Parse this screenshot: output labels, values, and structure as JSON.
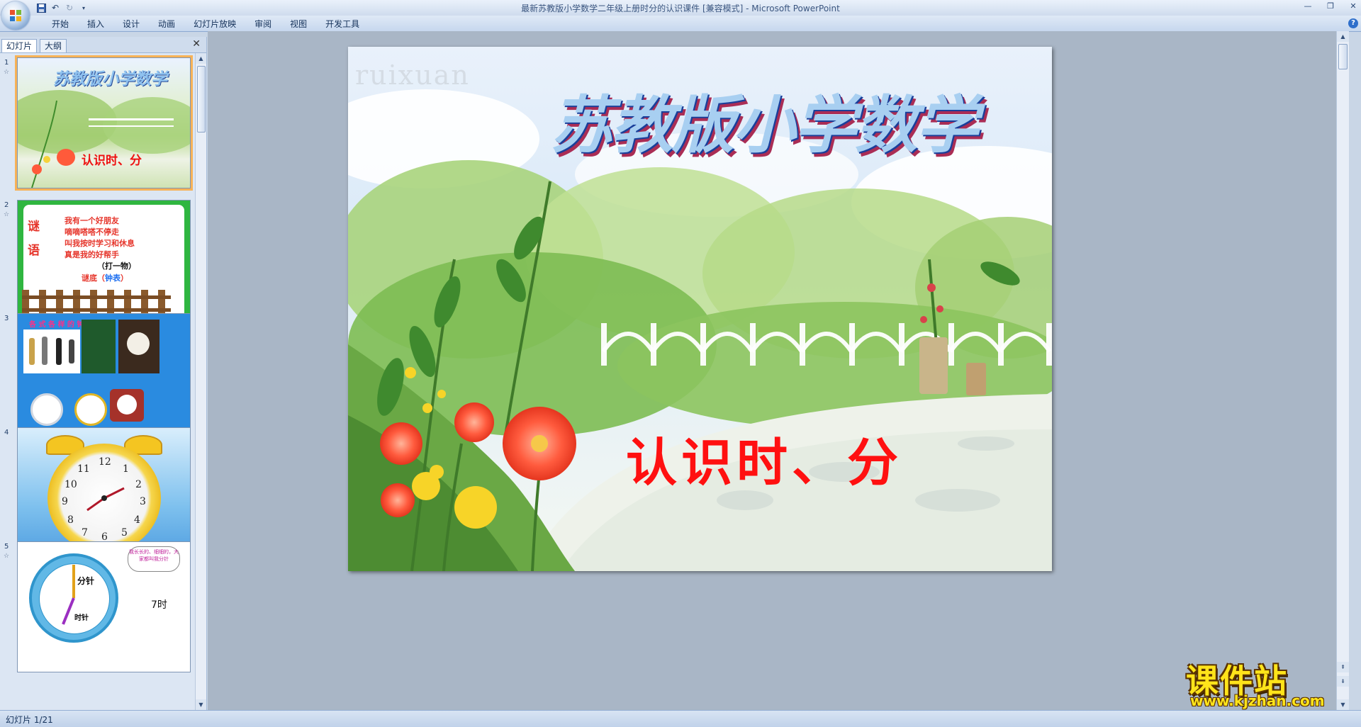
{
  "window": {
    "title": "最新苏教版小学数学二年级上册时分的认识课件 [兼容模式] - Microsoft PowerPoint"
  },
  "ribbon": {
    "tabs": [
      "开始",
      "插入",
      "设计",
      "动画",
      "幻灯片放映",
      "审阅",
      "视图",
      "开发工具"
    ]
  },
  "panel": {
    "tab_slides": "幻灯片",
    "tab_outline": "大纲",
    "close": "✕"
  },
  "thumbnails": [
    {
      "number": "1",
      "title": "苏教版小学数学",
      "subtitle": "认识时、分"
    },
    {
      "number": "2",
      "char1": "谜",
      "char2": "语",
      "lines": [
        "我有一个好朋友",
        "嘀嘀嗒嗒不停走",
        "叫我按时学习和休息",
        "真是我的好帮手"
      ],
      "hint": "（打一物）",
      "answer_label": "谜底（",
      "answer_value": "钟表",
      "answer_close": "）"
    },
    {
      "number": "3",
      "title": "各 式 各 样 的 钟 表"
    },
    {
      "number": "4",
      "clock_numbers": [
        "12",
        "1",
        "2",
        "3",
        "4",
        "5",
        "6",
        "7",
        "8",
        "9",
        "10",
        "11"
      ]
    },
    {
      "number": "5",
      "cloud_text": "我长长的、细细的，大家都叫我分针",
      "minute_label": "分针",
      "hour_label": "时针",
      "time_text": "7时"
    }
  ],
  "slide": {
    "watermark": "ruixuan",
    "title": "苏教版小学数学",
    "subtitle": "认识时、分"
  },
  "site_logo": {
    "name": "课件站",
    "url": "www.kjzhan.com"
  },
  "status": {
    "text": "幻灯片 1/21"
  },
  "colors": {
    "accent": "#f7b257",
    "title_fill": "#a8cff1",
    "subtitle": "#ff1010"
  }
}
